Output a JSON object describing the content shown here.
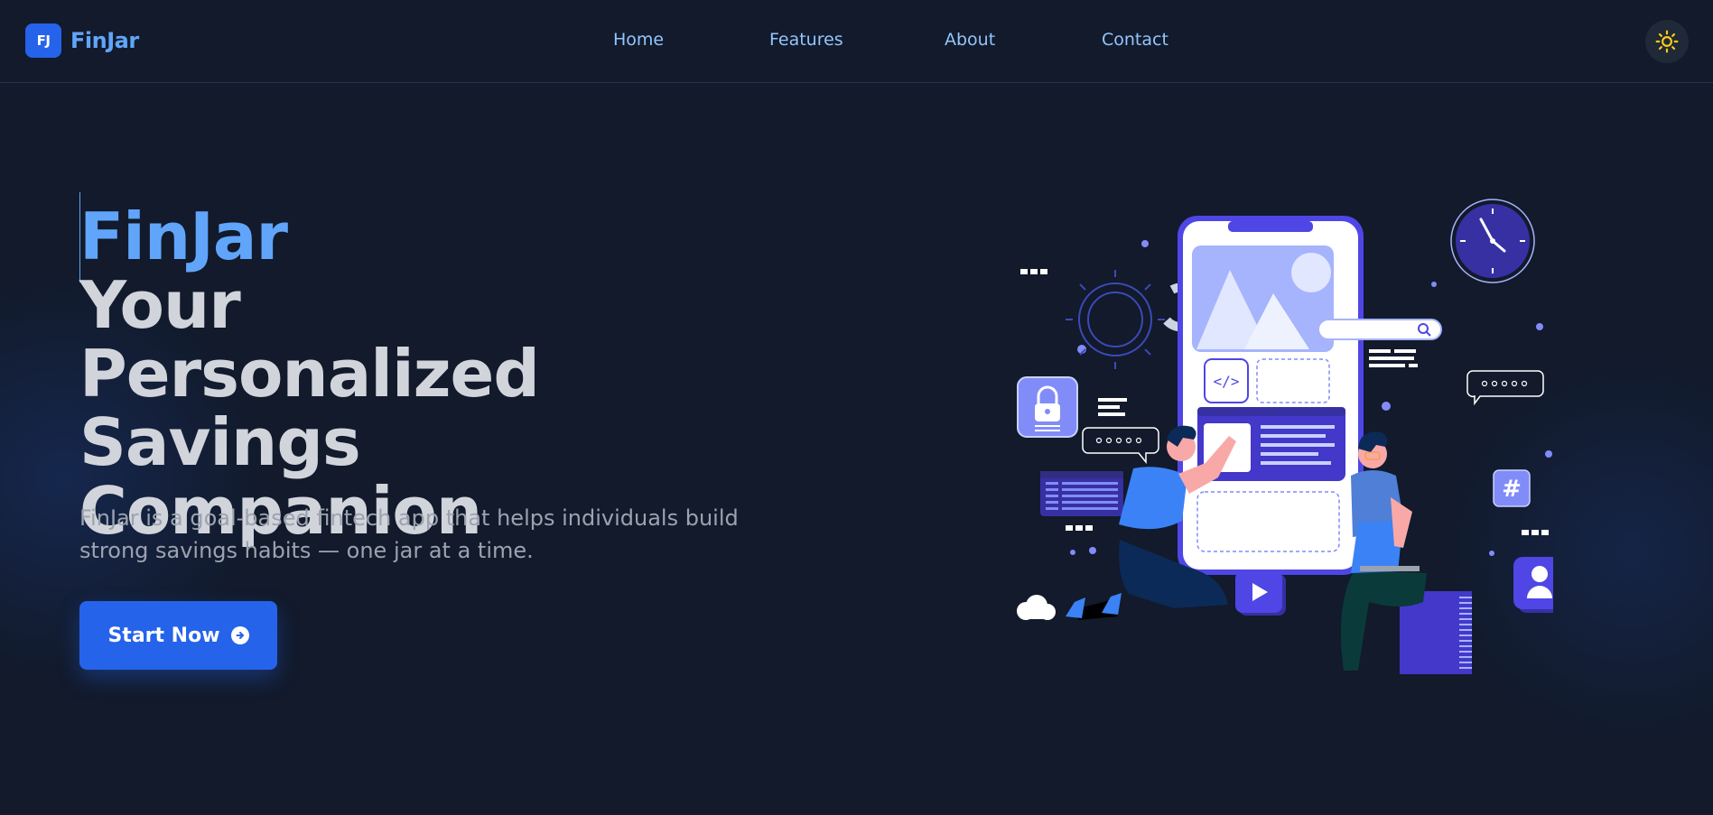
{
  "brand": {
    "logo_text": "FJ",
    "name": "FinJar"
  },
  "nav": {
    "items": [
      {
        "label": "Home"
      },
      {
        "label": "Features"
      },
      {
        "label": "About"
      },
      {
        "label": "Contact"
      }
    ]
  },
  "theme_toggle": {
    "icon": "sun-icon",
    "color": "#facc15"
  },
  "hero": {
    "title_brand": "FinJar",
    "title_main": "Your Personalized Savings Companion",
    "description": "FinJar is a goal-based fintech app that helps individuals build strong savings habits — one jar at a time.",
    "cta_label": "Start Now",
    "cta_icon": "arrow-right-circle-icon"
  },
  "illustration": {
    "subject": "mobile-app-development-illustration"
  },
  "colors": {
    "background": "#121a2b",
    "accent": "#2563eb",
    "brand_text": "#60a5fa",
    "nav_text": "#93c5fd"
  }
}
